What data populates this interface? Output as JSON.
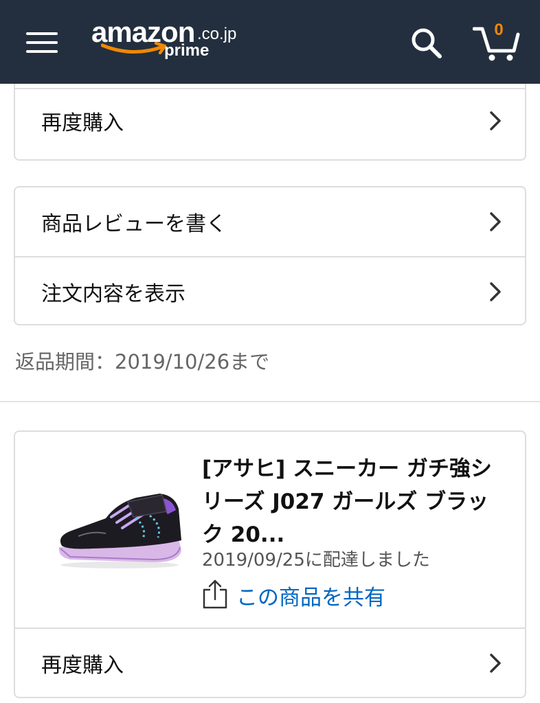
{
  "header": {
    "logo_word": "amazon",
    "logo_tld": ".co.jp",
    "logo_prime": "prime",
    "cart_count": "0",
    "icons": [
      "menu-icon",
      "search-icon",
      "cart-icon"
    ]
  },
  "card1": {
    "rebuy_label": "再度購入"
  },
  "card2": {
    "review_label": "商品レビューを書く",
    "order_details_label": "注文内容を表示"
  },
  "return_period": "返品期間：2019/10/26まで",
  "product": {
    "title": "[アサヒ] スニーカー ガチ強シリーズ J027 ガールズ ブラック 20...",
    "delivered": "2019/09/25に配達しました",
    "share_label": "この商品を共有",
    "rebuy_label": "再度購入"
  },
  "colors": {
    "header_bg": "#232f3e",
    "cart_count": "#f08804",
    "link": "#0066c0",
    "border": "#dddddd"
  }
}
